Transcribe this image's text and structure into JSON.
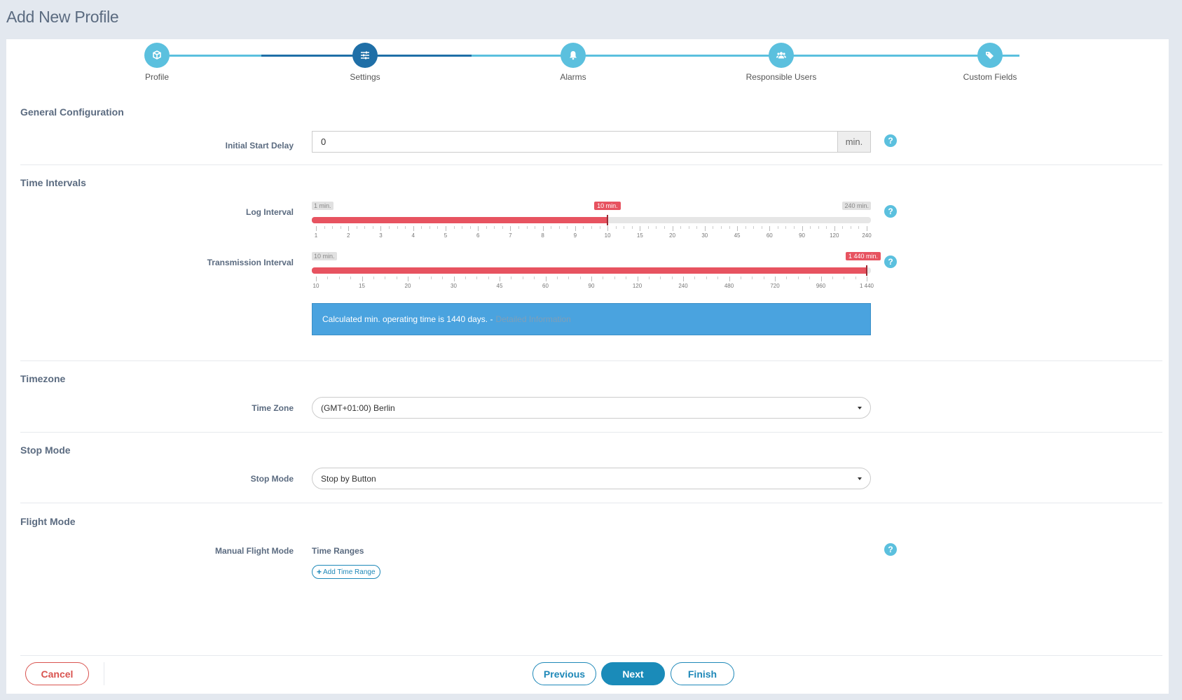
{
  "page_title": "Add New Profile",
  "stepper": {
    "steps": [
      {
        "label": "Profile",
        "icon": "cube-icon"
      },
      {
        "label": "Settings",
        "icon": "sliders-icon"
      },
      {
        "label": "Alarms",
        "icon": "bell-icon"
      },
      {
        "label": "Responsible Users",
        "icon": "users-icon"
      },
      {
        "label": "Custom Fields",
        "icon": "tags-icon"
      }
    ],
    "active_index": 1
  },
  "general": {
    "title": "General Configuration",
    "initial_start_delay": {
      "label": "Initial Start Delay",
      "value": "0",
      "unit": "min."
    }
  },
  "time_intervals": {
    "title": "Time Intervals",
    "log_interval": {
      "label": "Log Interval",
      "min_label": "1 min.",
      "max_label": "240 min.",
      "current_label": "10 min.",
      "ticks": [
        "1",
        "2",
        "3",
        "4",
        "5",
        "6",
        "7",
        "8",
        "9",
        "10",
        "15",
        "20",
        "30",
        "45",
        "60",
        "90",
        "120",
        "240"
      ],
      "value_index": 9
    },
    "transmission_interval": {
      "label": "Transmission Interval",
      "min_label": "10 min.",
      "current_label": "1 440 min.",
      "ticks": [
        "10",
        "15",
        "20",
        "30",
        "45",
        "60",
        "90",
        "120",
        "240",
        "480",
        "720",
        "960",
        "1 440"
      ],
      "value_index": 12
    },
    "info": {
      "text": "Calculated min. operating time is 1440 days. -",
      "link": "Detailed Information"
    }
  },
  "timezone": {
    "title": "Timezone",
    "field_label": "Time Zone",
    "value": "(GMT+01:00) Berlin"
  },
  "stop_mode": {
    "title": "Stop Mode",
    "field_label": "Stop Mode",
    "value": "Stop by Button"
  },
  "flight_mode": {
    "title": "Flight Mode",
    "field_label": "Manual Flight Mode",
    "sub_heading": "Time Ranges",
    "add_button": "Add Time Range"
  },
  "footer": {
    "cancel": "Cancel",
    "previous": "Previous",
    "next": "Next",
    "finish": "Finish"
  },
  "colors": {
    "accent": "#5bc0de",
    "active_step": "#1f6fa7",
    "slider_fill": "#e75360",
    "info_bg": "#4aa3df",
    "primary": "#1a8bb9",
    "danger": "#d9534f"
  }
}
